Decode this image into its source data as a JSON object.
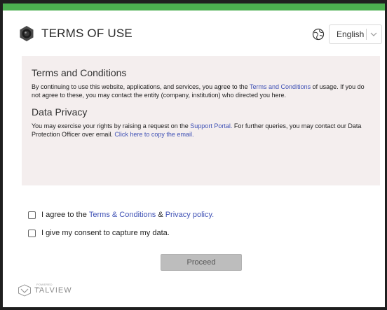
{
  "header": {
    "title": "TERMS OF USE",
    "language": {
      "selected": "English"
    }
  },
  "terms": {
    "heading": "Terms and Conditions",
    "text_before": "By continuing to use this website, applications, and services, you agree to the ",
    "link": "Terms and Conditions",
    "text_after": " of usage. If you do not agree to these, you may contact the entity (company, institution) who directed you here."
  },
  "privacy": {
    "heading": "Data Privacy",
    "text_before": "You may exercise your rights by raising a request on the ",
    "portal_link": "Support Portal.",
    "text_middle": " For further queries, you may contact our Data Protection Officer over email. ",
    "email_link": "Click here to copy the email."
  },
  "consent": {
    "agree_prefix": "I agree to the ",
    "terms_link": "Terms & Conditions",
    "ampersand": " & ",
    "privacy_link": "Privacy policy.",
    "capture_label": "I give my consent to capture my data."
  },
  "actions": {
    "proceed_label": "Proceed"
  },
  "footer": {
    "powered_by": "POWERED BY",
    "brand": "TALVIEW"
  },
  "colors": {
    "accent_bar": "#4caf50",
    "link": "#3f51b5",
    "panel_bg": "#f4eeee"
  }
}
